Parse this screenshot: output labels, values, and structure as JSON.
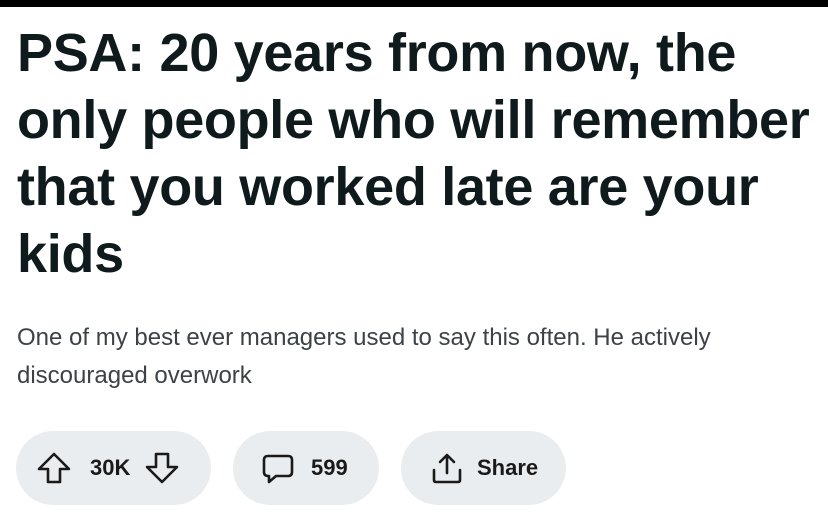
{
  "post": {
    "title": "PSA: 20 years from now, the only people who will remember that you worked late are your kids",
    "body": "One of my best ever managers used to say this often. He actively discouraged overwork"
  },
  "actions": {
    "vote_count": "30K",
    "comment_count": "599",
    "share_label": "Share",
    "icons": {
      "upvote": "arrow-up-icon",
      "downvote": "arrow-down-icon",
      "comment": "comment-bubble-icon",
      "share": "share-icon"
    }
  },
  "colors": {
    "background": "#ffffff",
    "title_text": "#0f1a1c",
    "body_text": "#3c4245",
    "pill_background": "#eaedef",
    "top_bar": "#000000"
  }
}
